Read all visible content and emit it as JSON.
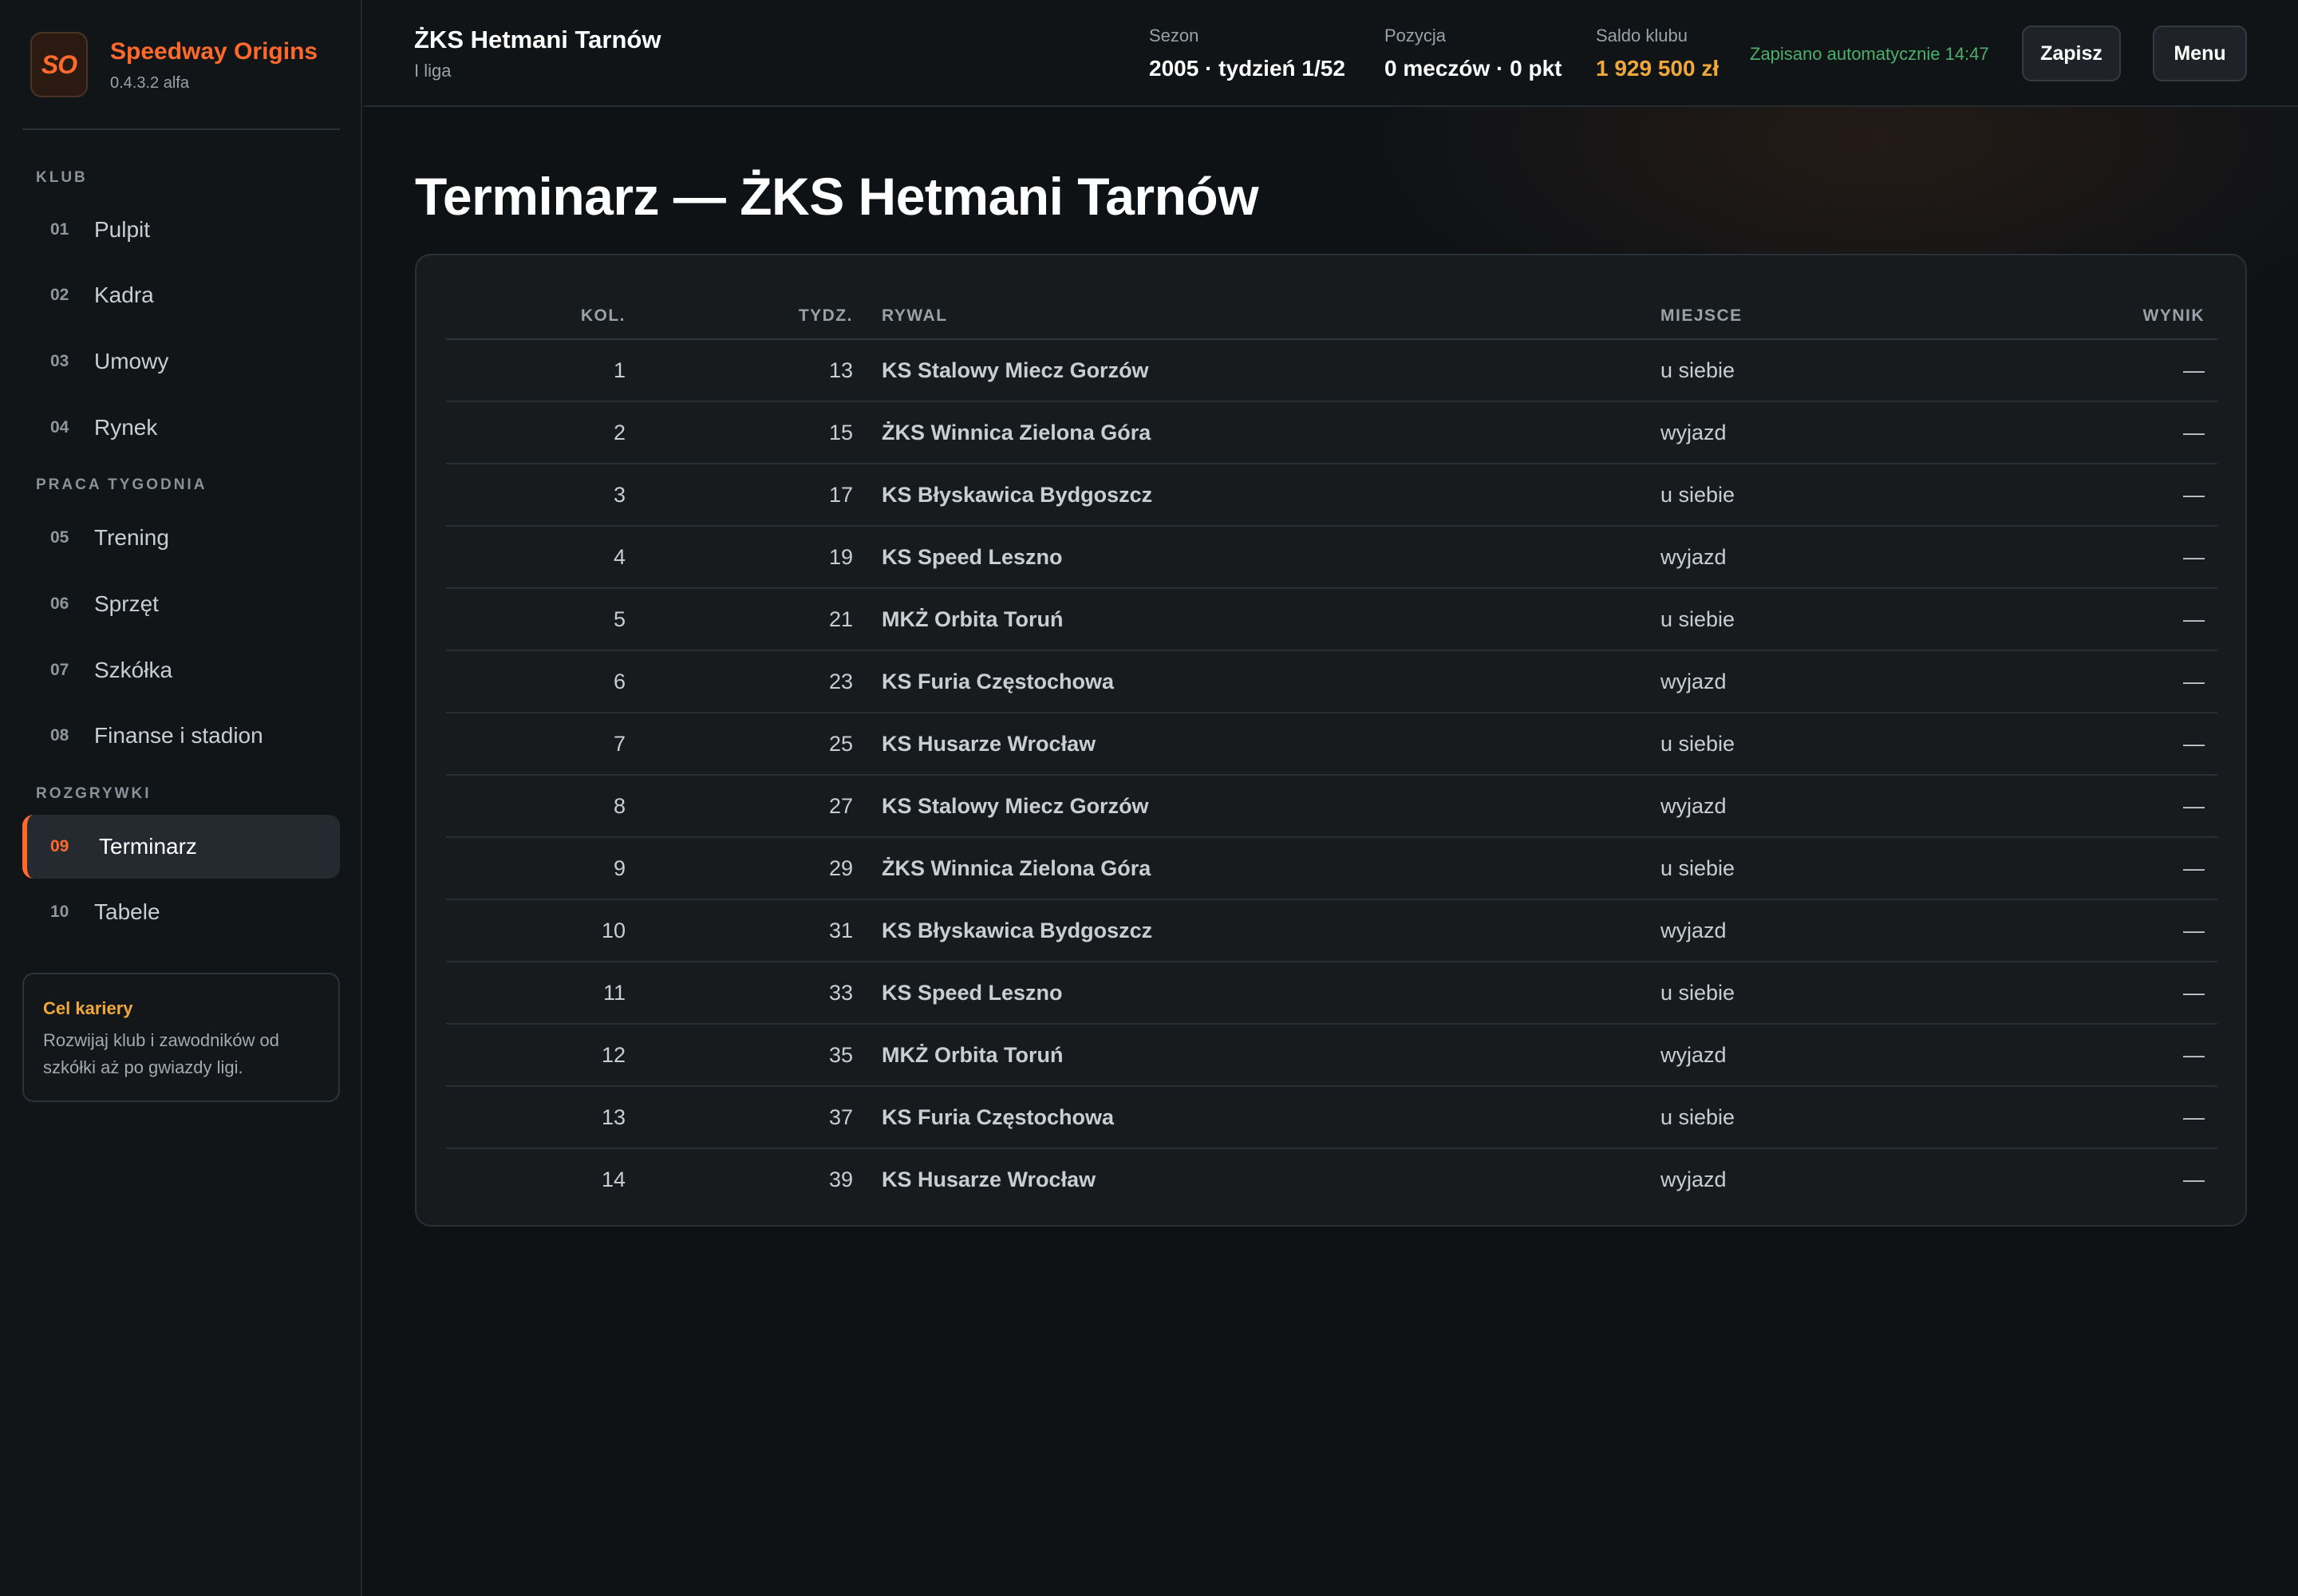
{
  "app": {
    "logo_text": "SO",
    "name": "Speedway Origins",
    "version": "0.4.3.2 alfa"
  },
  "sidebar": {
    "sections": [
      {
        "title": "Klub",
        "items": [
          {
            "num": "01",
            "label": "Pulpit"
          },
          {
            "num": "02",
            "label": "Kadra"
          },
          {
            "num": "03",
            "label": "Umowy"
          },
          {
            "num": "04",
            "label": "Rynek"
          }
        ]
      },
      {
        "title": "Praca tygodnia",
        "items": [
          {
            "num": "05",
            "label": "Trening"
          },
          {
            "num": "06",
            "label": "Sprzęt"
          },
          {
            "num": "07",
            "label": "Szkółka"
          },
          {
            "num": "08",
            "label": "Finanse i stadion"
          }
        ]
      },
      {
        "title": "Rozgrywki",
        "items": [
          {
            "num": "09",
            "label": "Terminarz",
            "active": true
          },
          {
            "num": "10",
            "label": "Tabele"
          }
        ]
      }
    ],
    "career": {
      "title": "Cel kariery",
      "text": "Rozwijaj klub i zawodników od szkółki aż po gwiazdy ligi."
    }
  },
  "header": {
    "club_name": "ŻKS Hetmani Tarnów",
    "league": "I liga",
    "season_label": "Sezon",
    "season_value": "2005 · tydzień 1/52",
    "position_label": "Pozycja",
    "position_value": "0 meczów · 0 pkt",
    "balance_label": "Saldo klubu",
    "balance_value": "1 929 500 zł",
    "autosave": "Zapisano automatycznie 14:47",
    "save_label": "Zapisz",
    "menu_label": "Menu"
  },
  "main": {
    "title": "Terminarz — ŻKS Hetmani Tarnów",
    "columns": {
      "kol": "Kol.",
      "tydz": "Tydz.",
      "rywal": "Rywal",
      "miejsce": "Miejsce",
      "wynik": "Wynik"
    },
    "rows": [
      {
        "kol": "1",
        "tydz": "13",
        "rywal": "KS Stalowy Miecz Gorzów",
        "miejsce": "u siebie",
        "wynik": "—"
      },
      {
        "kol": "2",
        "tydz": "15",
        "rywal": "ŻKS Winnica Zielona Góra",
        "miejsce": "wyjazd",
        "wynik": "—"
      },
      {
        "kol": "3",
        "tydz": "17",
        "rywal": "KS Błyskawica Bydgoszcz",
        "miejsce": "u siebie",
        "wynik": "—"
      },
      {
        "kol": "4",
        "tydz": "19",
        "rywal": "KS Speed Leszno",
        "miejsce": "wyjazd",
        "wynik": "—"
      },
      {
        "kol": "5",
        "tydz": "21",
        "rywal": "MKŻ Orbita Toruń",
        "miejsce": "u siebie",
        "wynik": "—"
      },
      {
        "kol": "6",
        "tydz": "23",
        "rywal": "KS Furia Częstochowa",
        "miejsce": "wyjazd",
        "wynik": "—"
      },
      {
        "kol": "7",
        "tydz": "25",
        "rywal": "KS Husarze Wrocław",
        "miejsce": "u siebie",
        "wynik": "—"
      },
      {
        "kol": "8",
        "tydz": "27",
        "rywal": "KS Stalowy Miecz Gorzów",
        "miejsce": "wyjazd",
        "wynik": "—"
      },
      {
        "kol": "9",
        "tydz": "29",
        "rywal": "ŻKS Winnica Zielona Góra",
        "miejsce": "u siebie",
        "wynik": "—"
      },
      {
        "kol": "10",
        "tydz": "31",
        "rywal": "KS Błyskawica Bydgoszcz",
        "miejsce": "wyjazd",
        "wynik": "—"
      },
      {
        "kol": "11",
        "tydz": "33",
        "rywal": "KS Speed Leszno",
        "miejsce": "u siebie",
        "wynik": "—"
      },
      {
        "kol": "12",
        "tydz": "35",
        "rywal": "MKŻ Orbita Toruń",
        "miejsce": "wyjazd",
        "wynik": "—"
      },
      {
        "kol": "13",
        "tydz": "37",
        "rywal": "KS Furia Częstochowa",
        "miejsce": "u siebie",
        "wynik": "—"
      },
      {
        "kol": "14",
        "tydz": "39",
        "rywal": "KS Husarze Wrocław",
        "miejsce": "wyjazd",
        "wynik": "—"
      }
    ]
  },
  "colors": {
    "accent": "#ff6a2b",
    "money": "#f0a83a",
    "autosave": "#4caf6b"
  }
}
